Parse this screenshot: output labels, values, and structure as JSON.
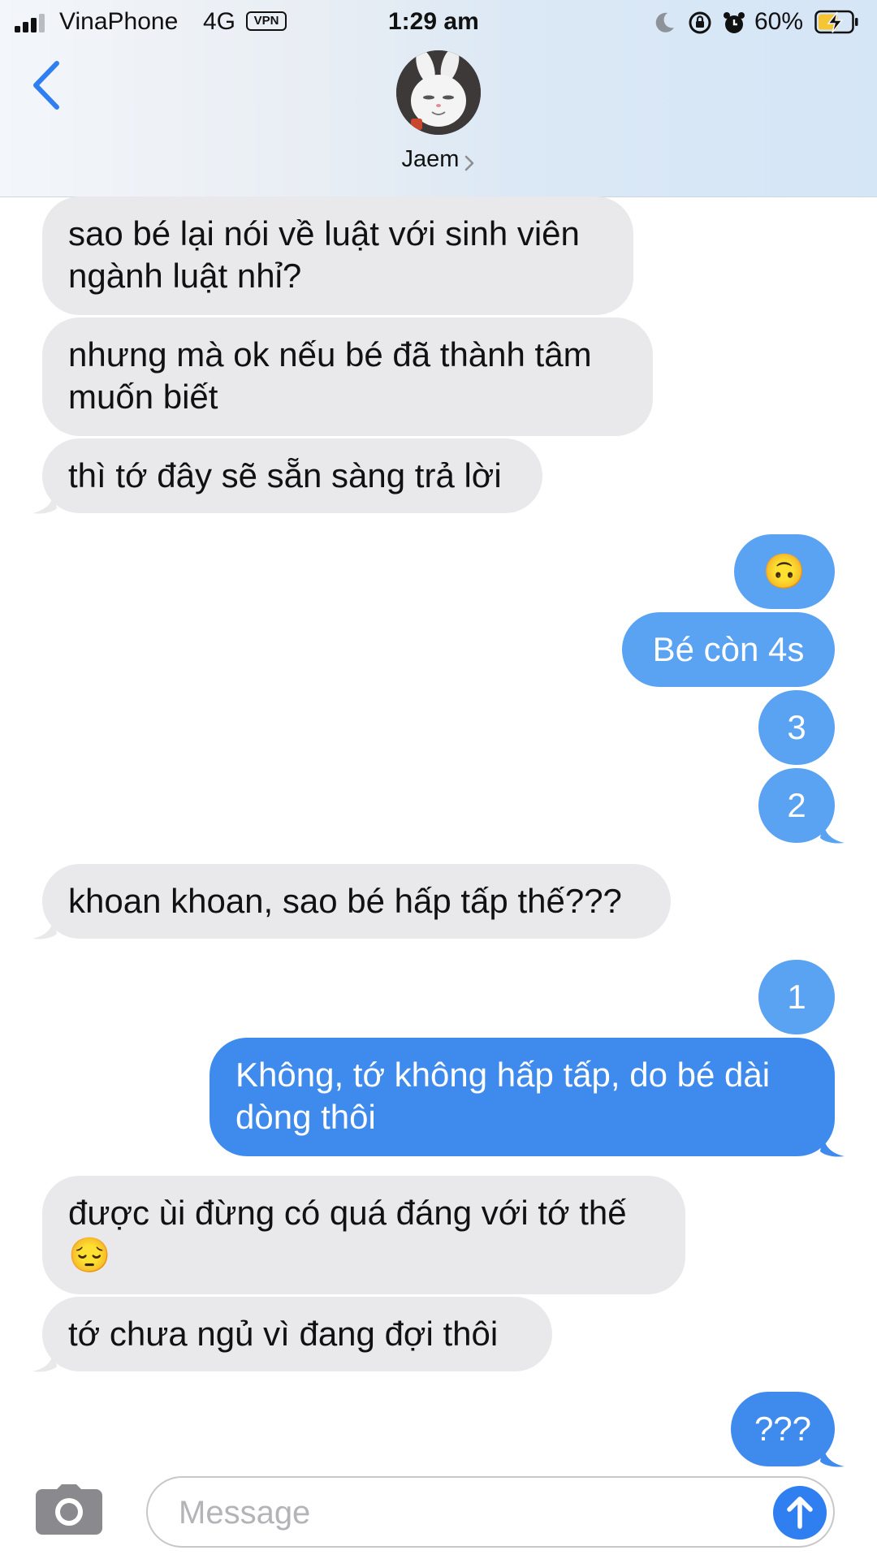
{
  "status_bar": {
    "carrier": "VinaPhone",
    "network": "4G",
    "vpn": "VPN",
    "time": "1:29 am",
    "battery_percent": "60%",
    "battery_level": 0.6,
    "signal_bars": 3,
    "icons": [
      "moon-icon",
      "rotation-lock-icon",
      "alarm-icon",
      "charging-bolt-icon"
    ]
  },
  "header": {
    "back_icon": "chevron-left-icon",
    "contact_name": "Jaem",
    "contact_chevron": "chevron-right-icon",
    "avatar": "bunny-avatar"
  },
  "messages": [
    {
      "side": "incoming",
      "text": "sao bé lại nói về luật với sinh viên\nngành luật nhỉ?"
    },
    {
      "side": "incoming",
      "text": "nhưng mà ok nếu bé đã thành tâm\nmuốn biết"
    },
    {
      "side": "incoming",
      "text": "thì tớ đây sẽ sẵn sàng trả lời"
    },
    {
      "side": "outgoing",
      "text": "🙃"
    },
    {
      "side": "outgoing",
      "text": "Bé còn 4s"
    },
    {
      "side": "outgoing",
      "text": "3"
    },
    {
      "side": "outgoing",
      "text": "2"
    },
    {
      "side": "incoming",
      "text": "khoan khoan, sao bé hấp tấp thế???"
    },
    {
      "side": "outgoing",
      "text": "1"
    },
    {
      "side": "outgoing",
      "text": "Không, tớ không hấp tấp, do bé dài\ndòng thôi"
    },
    {
      "side": "incoming",
      "text": "được ùi đừng có quá đáng với tớ thế\n😔"
    },
    {
      "side": "incoming",
      "text": "tớ chưa ngủ vì đang đợi thôi"
    },
    {
      "side": "outgoing",
      "text": "???"
    }
  ],
  "input_bar": {
    "camera_icon": "camera-icon",
    "placeholder": "Message",
    "send_icon": "arrow-up-icon"
  },
  "colors": {
    "incoming_bubble": "#e9e9eb",
    "outgoing_bubble": "#5aa2f2",
    "outgoing_bubble_dark": "#3f8bed",
    "accent": "#2f7ff0"
  }
}
